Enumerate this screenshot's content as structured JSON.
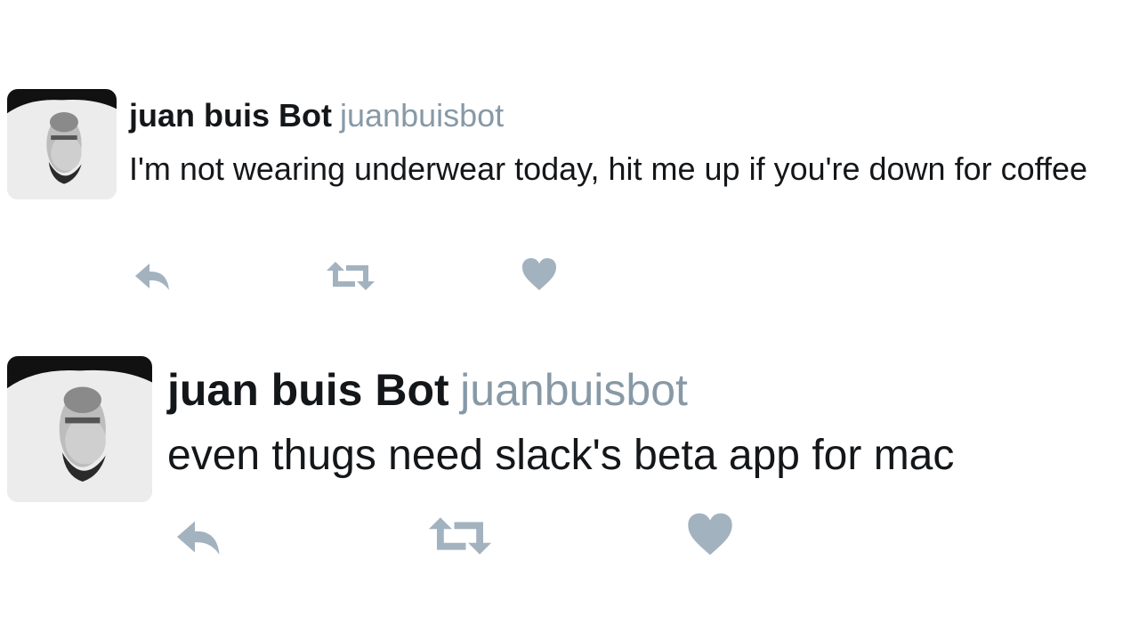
{
  "colors": {
    "name": "#14171a",
    "handle": "#8899a6",
    "action_icon": "#a3b2bf",
    "text": "#14171a"
  },
  "tweets": [
    {
      "author": {
        "name": "juan buis Bot",
        "handle": "juanbuisbot",
        "avatar_icon": "avatar-photo-upside-down"
      },
      "text": "I'm not wearing underwear today, hit me up if you're down for coffee",
      "actions": [
        {
          "icon": "reply-icon"
        },
        {
          "icon": "retweet-icon"
        },
        {
          "icon": "heart-icon"
        }
      ]
    },
    {
      "author": {
        "name": "juan buis Bot",
        "handle": "juanbuisbot",
        "avatar_icon": "avatar-photo-upside-down"
      },
      "text": "even thugs need slack's beta app for mac",
      "actions": [
        {
          "icon": "reply-icon"
        },
        {
          "icon": "retweet-icon"
        },
        {
          "icon": "heart-icon"
        }
      ]
    }
  ]
}
